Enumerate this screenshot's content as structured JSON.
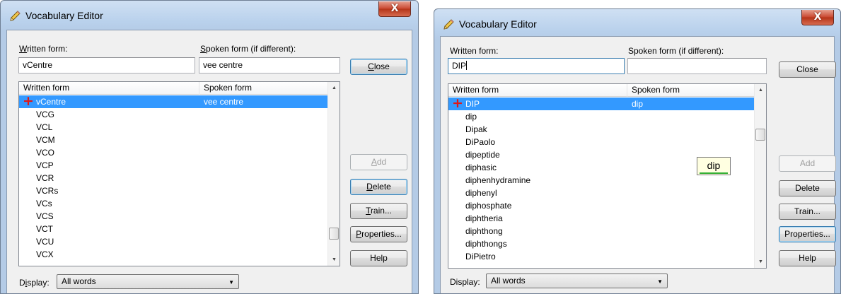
{
  "dialogs": [
    {
      "title": "Vocabulary Editor",
      "close_glyph": "X",
      "written_label": "Written form:",
      "spoken_label": "Spoken form (if different):",
      "written_value": "vCentre",
      "spoken_value": "vee centre",
      "buttons": {
        "close": "Close",
        "add": "Add",
        "delete": "Delete",
        "train": "Train...",
        "properties": "Properties...",
        "help": "Help"
      },
      "columns": [
        "Written form",
        "Spoken form"
      ],
      "rows": [
        {
          "written": "vCentre",
          "spoken": "vee centre"
        },
        {
          "written": "VCG",
          "spoken": ""
        },
        {
          "written": "VCL",
          "spoken": ""
        },
        {
          "written": "VCM",
          "spoken": ""
        },
        {
          "written": "VCO",
          "spoken": ""
        },
        {
          "written": "VCP",
          "spoken": ""
        },
        {
          "written": "VCR",
          "spoken": ""
        },
        {
          "written": "VCRs",
          "spoken": ""
        },
        {
          "written": "VCs",
          "spoken": ""
        },
        {
          "written": "VCS",
          "spoken": ""
        },
        {
          "written": "VCT",
          "spoken": ""
        },
        {
          "written": "VCU",
          "spoken": ""
        },
        {
          "written": "VCX",
          "spoken": ""
        }
      ],
      "display_label": "Display:",
      "display_value": "All words"
    },
    {
      "title": "Vocabulary Editor",
      "close_glyph": "X",
      "written_label": "Written form:",
      "spoken_label": "Spoken form (if different):",
      "written_value": "DIP",
      "spoken_value": "",
      "buttons": {
        "close": "Close",
        "add": "Add",
        "delete": "Delete",
        "train": "Train...",
        "properties": "Properties...",
        "help": "Help"
      },
      "columns": [
        "Written form",
        "Spoken form"
      ],
      "rows": [
        {
          "written": "DIP",
          "spoken": "dip"
        },
        {
          "written": "dip",
          "spoken": ""
        },
        {
          "written": "Dipak",
          "spoken": ""
        },
        {
          "written": "DiPaolo",
          "spoken": ""
        },
        {
          "written": "dipeptide",
          "spoken": ""
        },
        {
          "written": "diphasic",
          "spoken": ""
        },
        {
          "written": "diphenhydramine",
          "spoken": ""
        },
        {
          "written": "diphenyl",
          "spoken": ""
        },
        {
          "written": "diphosphate",
          "spoken": ""
        },
        {
          "written": "diphtheria",
          "spoken": ""
        },
        {
          "written": "diphthong",
          "spoken": ""
        },
        {
          "written": "diphthongs",
          "spoken": ""
        },
        {
          "written": "DiPietro",
          "spoken": ""
        }
      ],
      "tooltip": "dip",
      "display_label": "Display:",
      "display_value": "All words"
    }
  ],
  "icons": {
    "title": "pencil-icon",
    "new_word": "plus-icon",
    "scroll_up": "up-arrow-icon",
    "scroll_down": "down-arrow-icon",
    "dropdown": "chevron-down-icon"
  },
  "colors": {
    "selection": "#3399ff",
    "plus": "#e01818",
    "close_button": "#c9462e"
  }
}
